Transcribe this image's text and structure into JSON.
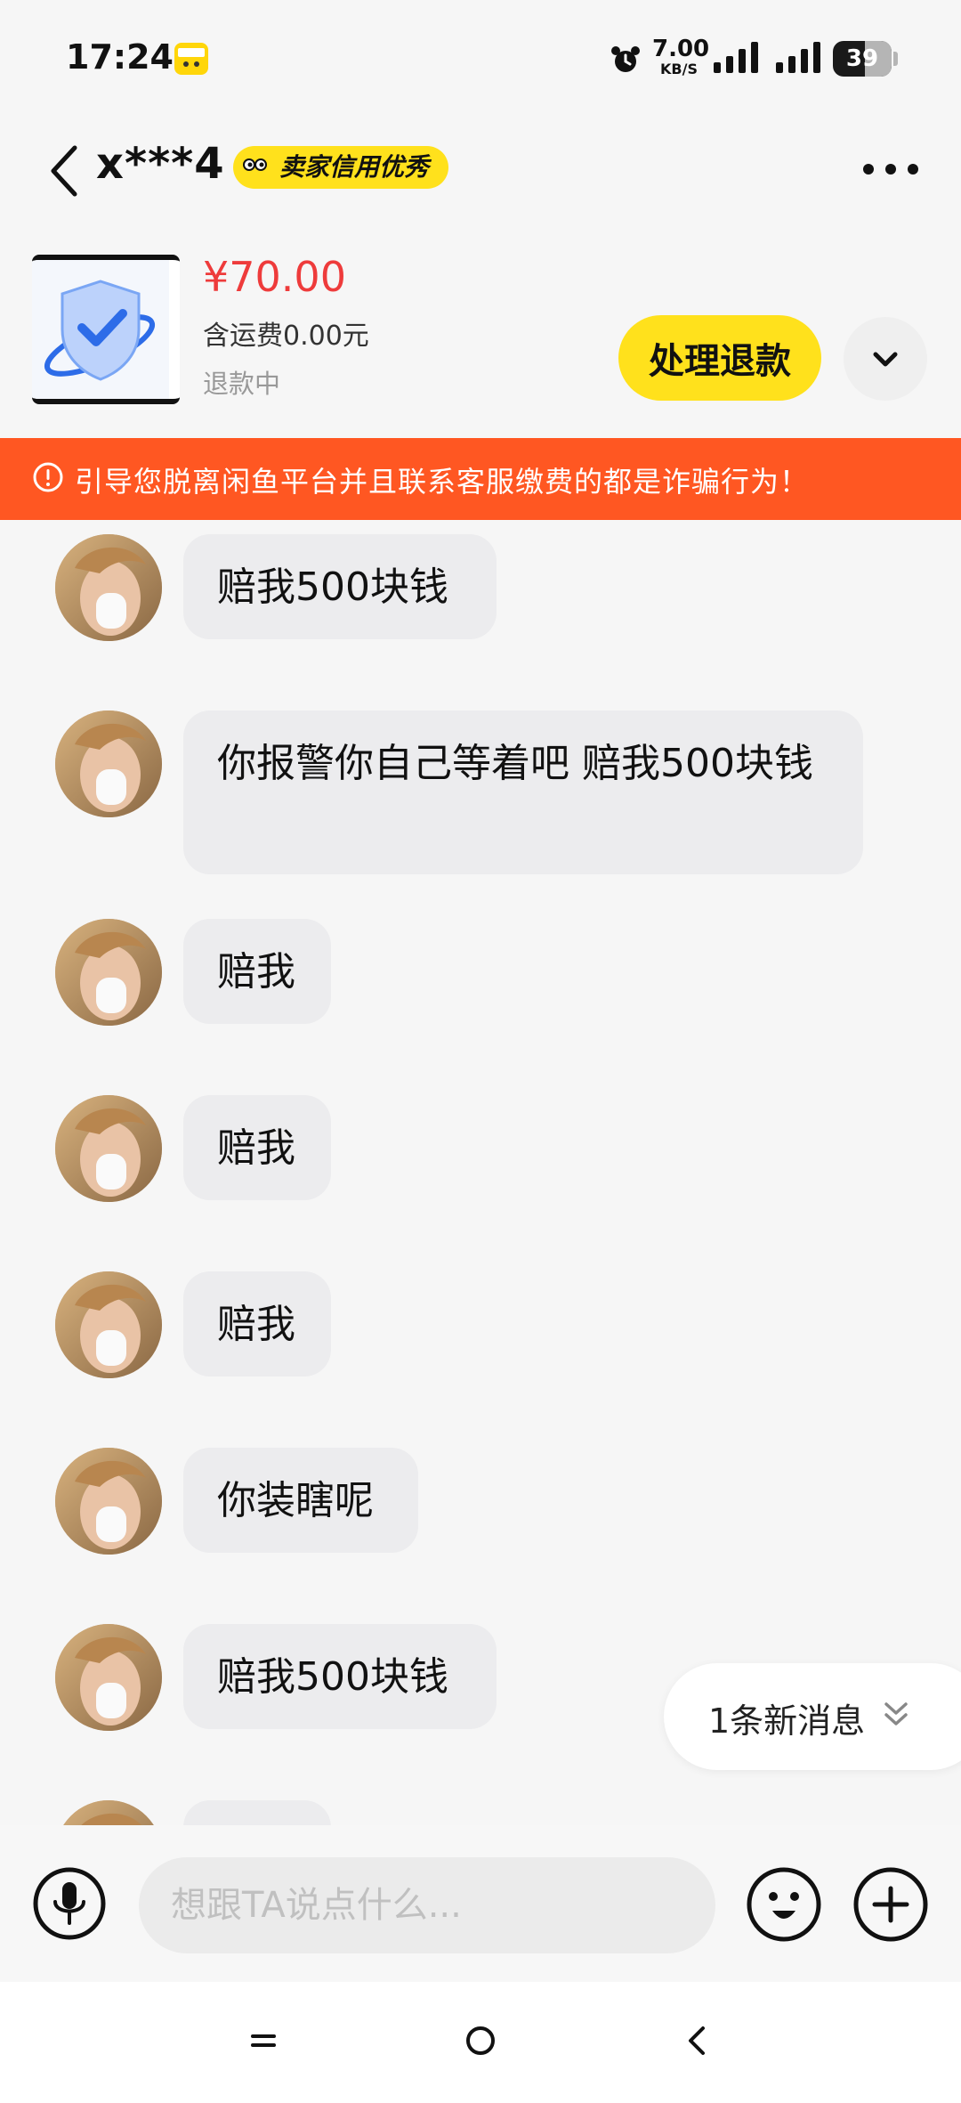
{
  "status_bar": {
    "time": "17:24",
    "net_speed_value": "7.00",
    "net_speed_unit": "KB/S",
    "battery": "39",
    "icons": [
      "app-notification-icon",
      "alarm-icon",
      "signal-icon",
      "signal-icon",
      "battery-icon"
    ]
  },
  "header": {
    "contact_name": "x***4",
    "credit_badge": "卖家信用优秀",
    "back_icon": "chevron-left-icon",
    "more_icon": "more-horizontal-icon"
  },
  "product": {
    "price": "¥70.00",
    "shipping": "含运费0.00元",
    "status": "退款中",
    "action_button": "处理退款",
    "dropdown_icon": "chevron-down-icon"
  },
  "warning": {
    "text": "引导您脱离闲鱼平台并且联系客服缴费的都是诈骗行为！",
    "icon": "alert-circle-icon",
    "color": "#ff5722"
  },
  "messages": [
    {
      "text": "赔我500块钱"
    },
    {
      "text": "你报警你自己等着吧 赔我500块钱"
    },
    {
      "text": "赔我"
    },
    {
      "text": "赔我"
    },
    {
      "text": "赔我"
    },
    {
      "text": "你装瞎呢"
    },
    {
      "text": "赔我500块钱"
    }
  ],
  "new_message_pill": {
    "label": "1条新消息",
    "icon": "chevrons-down-icon"
  },
  "input_bar": {
    "placeholder": "想跟TA说点什么...",
    "value": "",
    "icons": [
      "microphone-icon",
      "emoji-icon",
      "plus-icon"
    ]
  },
  "nav_bar": {
    "icons": [
      "menu-icon",
      "home-icon",
      "back-icon"
    ]
  },
  "colors": {
    "accent_yellow": "#ffe11c",
    "price_red": "#ee3b3b",
    "bubble_gray": "#ececee"
  }
}
